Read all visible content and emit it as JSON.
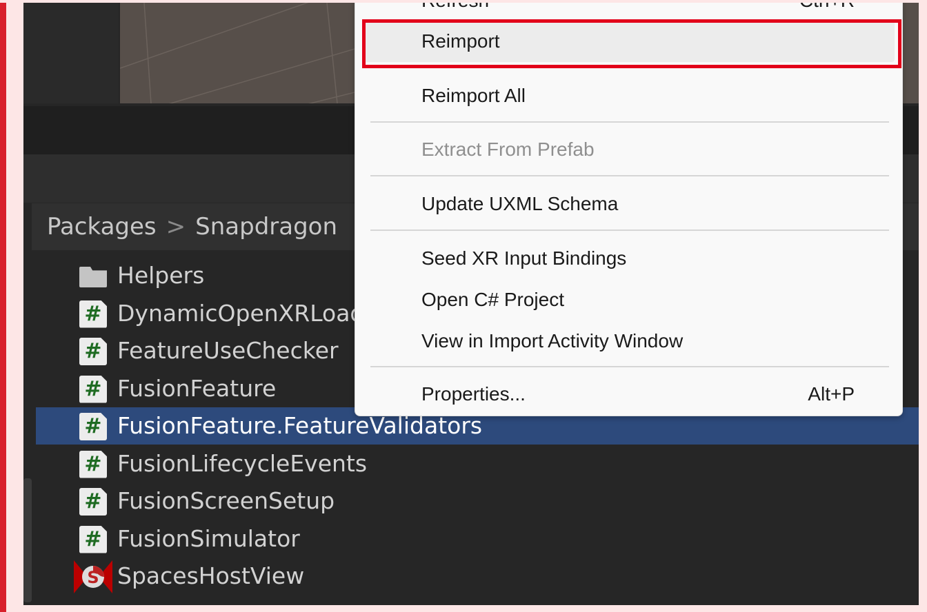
{
  "breadcrumb": [
    "Packages",
    "Snapdragon"
  ],
  "files": [
    {
      "name": "Helpers",
      "icon": "folder-icon"
    },
    {
      "name": "DynamicOpenXRLoader",
      "icon": "csharp-script-icon"
    },
    {
      "name": "FeatureUseChecker",
      "icon": "csharp-script-icon"
    },
    {
      "name": "FusionFeature",
      "icon": "csharp-script-icon"
    },
    {
      "name": "FusionFeature.FeatureValidators",
      "icon": "csharp-script-icon",
      "selected": true
    },
    {
      "name": "FusionLifecycleEvents",
      "icon": "csharp-script-icon"
    },
    {
      "name": "FusionScreenSetup",
      "icon": "csharp-script-icon"
    },
    {
      "name": "FusionSimulator",
      "icon": "csharp-script-icon"
    },
    {
      "name": "SpacesHostView",
      "icon": "spaces-asset-icon"
    }
  ],
  "script_glyph": "#",
  "menu": {
    "items": [
      {
        "label": "Refresh",
        "shortcut": "Ctrl+R"
      },
      {
        "label": "Reimport",
        "highlighted": true
      },
      {
        "label": "Reimport All"
      },
      {
        "label": "Extract From Prefab",
        "disabled": true
      },
      {
        "label": "Update UXML Schema"
      },
      {
        "label": "Seed XR Input Bindings"
      },
      {
        "label": "Open C# Project"
      },
      {
        "label": "View in Import Activity Window"
      },
      {
        "label": "Properties...",
        "shortcut": "Alt+P"
      }
    ]
  },
  "colors": {
    "highlight_box": "#e2001a",
    "selection": "#2d4a7c",
    "script_hash": "#1e6b22"
  }
}
